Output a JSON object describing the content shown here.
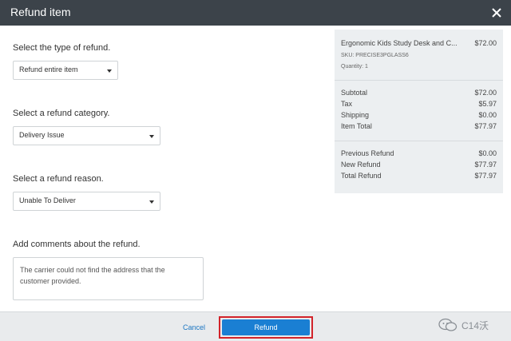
{
  "dialog": {
    "title": "Refund item",
    "close_icon": "close-icon"
  },
  "form": {
    "type_label": "Select the type of refund.",
    "type_value": "Refund entire item",
    "category_label": "Select a refund category.",
    "category_value": "Delivery Issue",
    "reason_label": "Select a refund reason.",
    "reason_value": "Unable To Deliver",
    "comments_label": "Add comments about the refund.",
    "comments_value": "The carrier could not find the address that the customer provided."
  },
  "summary": {
    "product_name": "Ergonomic Kids Study Desk and C...",
    "product_price": "$72.00",
    "sku": "SKU: PRECISE3PGLASS6",
    "quantity": "Quantity: 1",
    "rows": [
      {
        "label": "Subtotal",
        "amount": "$72.00"
      },
      {
        "label": "Tax",
        "amount": "$5.97"
      },
      {
        "label": "Shipping",
        "amount": "$0.00"
      },
      {
        "label": "Item Total",
        "amount": "$77.97"
      }
    ],
    "refund_rows": [
      {
        "label": "Previous Refund",
        "amount": "$0.00"
      },
      {
        "label": "New Refund",
        "amount": "$77.97"
      },
      {
        "label": "Total Refund",
        "amount": "$77.97"
      }
    ]
  },
  "footer": {
    "cancel_label": "Cancel",
    "refund_label": "Refund"
  },
  "watermark": {
    "text": "C14沃"
  },
  "colors": {
    "titlebar": "#3c434a",
    "primary": "#1a7fd3",
    "highlight": "#d2232a",
    "link": "#1a75c2"
  }
}
